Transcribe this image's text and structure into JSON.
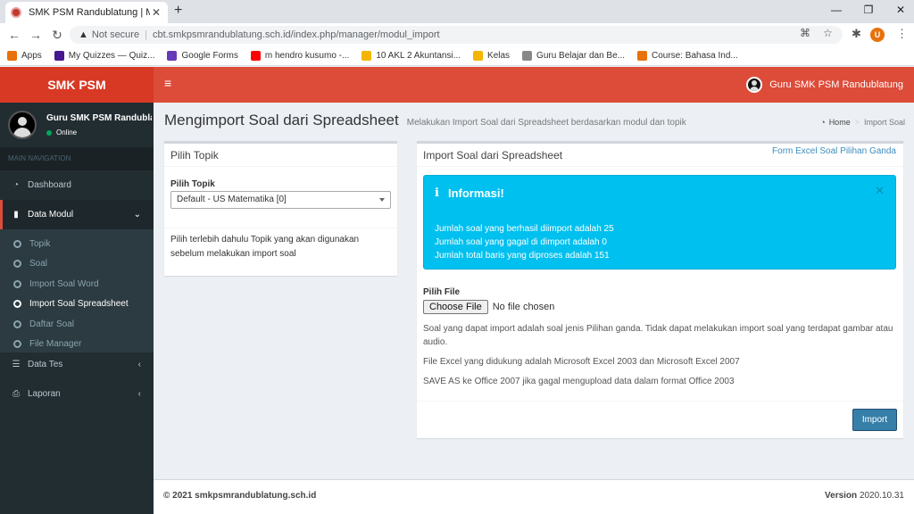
{
  "browser": {
    "tab_title": "SMK PSM Randublatung | Mengi",
    "address_not_secure": "Not secure",
    "address_url": "cbt.smkpsmrandublatung.sch.id/index.php/manager/modul_import",
    "profile_initial": "U",
    "bookmarks": [
      {
        "label": "Apps",
        "color": "#e8710a",
        "icon": "apps-grid-icon"
      },
      {
        "label": "My Quizzes — Quiz...",
        "color": "#46178f",
        "icon": "quizizz-icon"
      },
      {
        "label": "Google Forms",
        "color": "#673ab7",
        "icon": "forms-icon"
      },
      {
        "label": "m hendro kusumo -...",
        "color": "#ff0000",
        "icon": "youtube-icon"
      },
      {
        "label": "10 AKL 2 Akuntansi...",
        "color": "#f4b400",
        "icon": "classroom-icon"
      },
      {
        "label": "Kelas",
        "color": "#f4b400",
        "icon": "classroom-icon"
      },
      {
        "label": "Guru Belajar dan Be...",
        "color": "#888888",
        "icon": "guru-icon"
      },
      {
        "label": "Course: Bahasa Ind...",
        "color": "#e8710a",
        "icon": "moodle-icon"
      }
    ]
  },
  "header": {
    "logo": "SMK PSM",
    "user_name": "Guru SMK PSM Randublatung"
  },
  "sidebar": {
    "user_name": "Guru SMK PSM Randublatung",
    "status": "Online",
    "section": "MAIN NAVIGATION",
    "items": [
      {
        "label": "Dashboard"
      },
      {
        "label": "Data Modul"
      },
      {
        "label": "Data Tes"
      },
      {
        "label": "Laporan"
      }
    ],
    "submenu": [
      {
        "label": "Topik"
      },
      {
        "label": "Soal"
      },
      {
        "label": "Import Soal Word"
      },
      {
        "label": "Import Soal Spreadsheet"
      },
      {
        "label": "Daftar Soal"
      },
      {
        "label": "File Manager"
      }
    ]
  },
  "page": {
    "title": "Mengimport Soal dari Spreadsheet",
    "subtitle": "Melakukan Import Soal dari Spreadsheet berdasarkan modul dan topik",
    "breadcrumb_home": "Home",
    "breadcrumb_current": "Import Soal"
  },
  "topic_box": {
    "title": "Pilih Topik",
    "label": "Pilih Topik",
    "selected": "Default - US Matematika [0]",
    "hint": "Pilih terlebih dahulu Topik yang akan digunakan sebelum melakukan import soal"
  },
  "import_box": {
    "title": "Import Soal dari Spreadsheet",
    "link": "Form Excel Soal Pilihan Ganda",
    "alert_title": "Informasi!",
    "alert_lines": [
      "Jumlah soal yang berhasil diimport adalah 25",
      "Jumlah soal yang gagal di dimport adalah 0",
      "Jumlah total baris yang diproses adalah 151"
    ],
    "file_label": "Pilih File",
    "choose_button": "Choose File",
    "no_file": "No file chosen",
    "notes": [
      "Soal yang dapat import adalah soal jenis Pilihan ganda. Tidak dapat melakukan import soal yang terdapat gambar atau audio.",
      "File Excel yang didukung adalah Microsoft Excel 2003 dan Microsoft Excel 2007",
      "SAVE AS ke Office 2007 jika gagal mengupload data dalam format Office 2003"
    ],
    "import_button": "Import"
  },
  "footer": {
    "copyright": "© 2021 smkpsmrandublatung.sch.id",
    "version_label": "Version",
    "version": "2020.10.31"
  }
}
